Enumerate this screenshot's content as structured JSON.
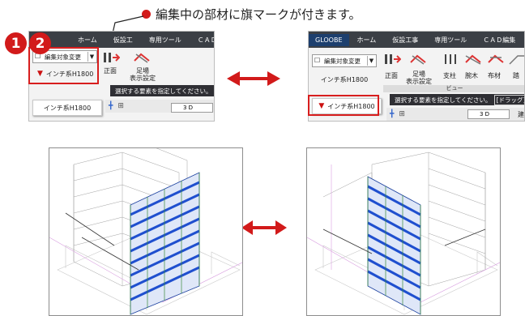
{
  "callout": {
    "text": "編集中の部材に旗マークが付きます。"
  },
  "badges": [
    "1",
    "2"
  ],
  "left_panel": {
    "tabs": [
      "ホーム",
      "仮設工",
      "専用ツール",
      "ＣＡＤ編集"
    ],
    "edit_target_button": "編集対象変更",
    "current_target": "インチ系H1800",
    "dropdown_item": "インチ系H1800",
    "commands": [
      "正面",
      "足場\n表示設定"
    ],
    "status_text": "選択する要素を指定してください。",
    "view_mode": "3 D"
  },
  "right_panel": {
    "tabs": [
      "GLOOBE",
      "ホーム",
      "仮設工事",
      "専用ツール",
      "ＣＡＤ編集"
    ],
    "edit_target_button": "編集対象変更",
    "current_target": "インチ系H1800",
    "flagged_item": "インチ系H1800",
    "commands": [
      "正面",
      "足場\n表示設定",
      "支柱",
      "腕木",
      "布材",
      "踏"
    ],
    "group_label": "ビュー",
    "status_text": "選択する要素を指定してください。",
    "status_hint": "[ドラッグ] 範",
    "view_mode": "3 D",
    "mode_label": "建"
  },
  "colors": {
    "accent": "#d21a1a",
    "scaffold": "#1f4fcf",
    "tabbar": "#3b3f45"
  }
}
